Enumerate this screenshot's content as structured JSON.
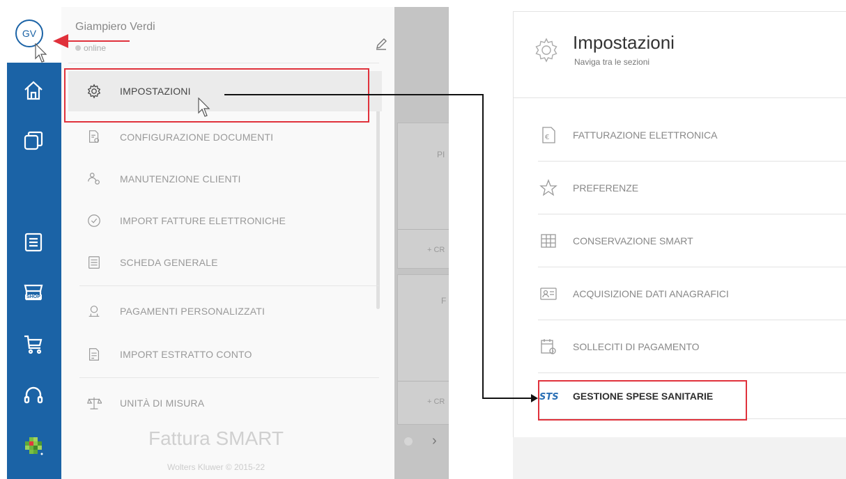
{
  "user": {
    "initials": "GV",
    "name": "Giampiero Verdi",
    "status": "online"
  },
  "rail": {
    "icons": [
      "home-icon",
      "windows-icon",
      "document-list-icon",
      "shop-icon",
      "cart-icon",
      "headset-icon",
      "pixel-logo-icon"
    ],
    "shop_label": "SHOP"
  },
  "menu": {
    "items": [
      {
        "label": "IMPOSTAZIONI",
        "icon": "gear-icon",
        "active": true
      },
      {
        "label": "CONFIGURAZIONE DOCUMENTI",
        "icon": "documents-settings-icon"
      },
      {
        "label": "MANUTENZIONE CLIENTI",
        "icon": "users-settings-icon"
      },
      {
        "label": "IMPORT FATTURE ELETTRONICHE",
        "icon": "clock-import-icon"
      },
      {
        "label": "SCHEDA GENERALE",
        "icon": "sheet-icon"
      },
      {
        "label": "PAGAMENTI PERSONALIZZATI",
        "icon": "payments-icon"
      },
      {
        "label": "IMPORT ESTRATTO CONTO",
        "icon": "statement-icon"
      },
      {
        "label": "UNITÀ DI MISURA",
        "icon": "scale-icon"
      }
    ]
  },
  "background": {
    "card_labels": [
      "PI",
      "+ CR",
      "F",
      "+ CR"
    ]
  },
  "brand": {
    "product": "Fattura SMART",
    "copyright": "Wolters Kluwer © 2015-22"
  },
  "settings": {
    "title": "Impostazioni",
    "subtitle": "Naviga tra le sezioni",
    "items": [
      {
        "label": "FATTURAZIONE ELETTRONICA",
        "icon": "euro-document-icon"
      },
      {
        "label": "PREFERENZE",
        "icon": "star-icon"
      },
      {
        "label": "CONSERVAZIONE SMART",
        "icon": "archive-grid-icon"
      },
      {
        "label": "ACQUISIZIONE DATI ANAGRAFICI",
        "icon": "id-card-icon"
      },
      {
        "label": "SOLLECITI DI PAGAMENTO",
        "icon": "calendar-reminder-icon"
      },
      {
        "label": "GESTIONE SPESE SANITARIE",
        "icon": "sts-logo-icon",
        "highlighted": true
      }
    ]
  },
  "colors": {
    "rail_blue": "#1b63a6",
    "annotation_red": "#e0313b",
    "sts_blue": "#2a6fb5"
  }
}
